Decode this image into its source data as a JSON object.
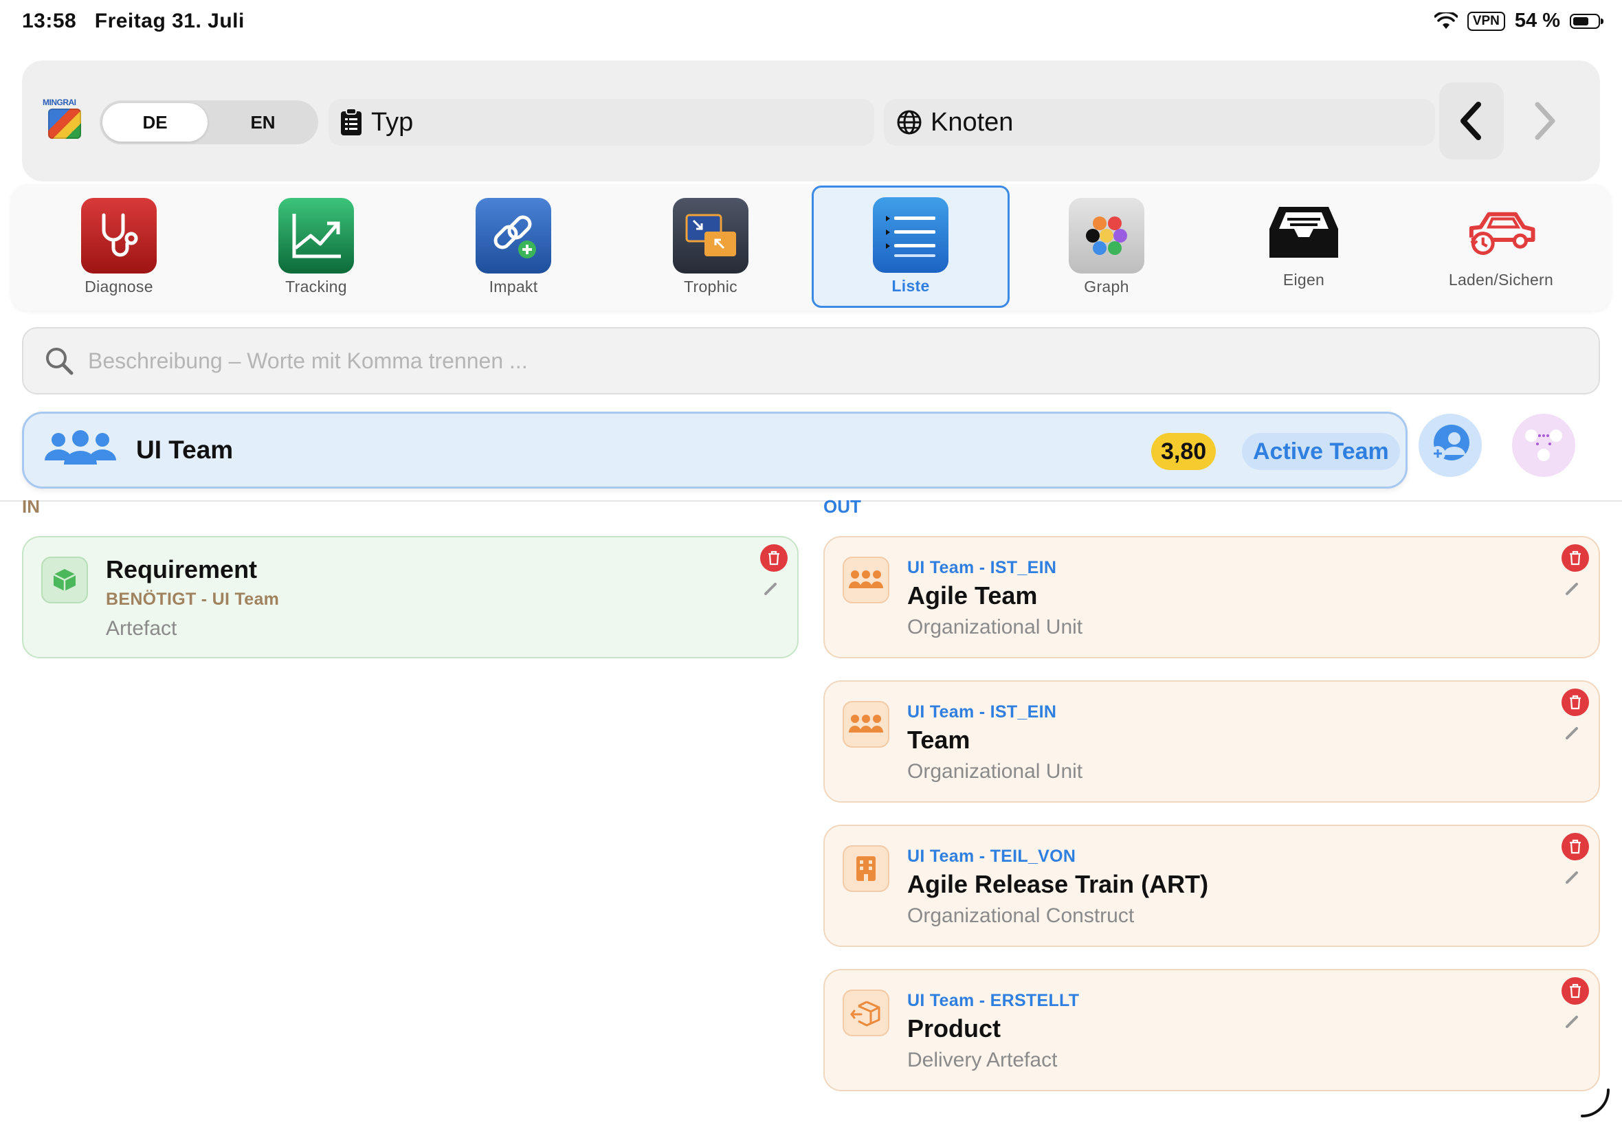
{
  "status_bar": {
    "time": "13:58",
    "date": "Freitag 31. Juli",
    "vpn": "VPN",
    "battery": "54 %"
  },
  "logo": {
    "text": "MINGRAI"
  },
  "language": {
    "active": "DE",
    "inactive": "EN"
  },
  "fields": {
    "type_label": "Typ",
    "node_label": "Knoten"
  },
  "tools": [
    {
      "label": "Diagnose",
      "icon": "stethoscope-icon"
    },
    {
      "label": "Tracking",
      "icon": "chart-trend-icon"
    },
    {
      "label": "Impakt",
      "icon": "link-add-icon"
    },
    {
      "label": "Trophic",
      "icon": "resize-arrows-icon"
    },
    {
      "label": "Liste",
      "icon": "list-icon",
      "selected": true
    },
    {
      "label": "Graph",
      "icon": "color-dots-icon"
    },
    {
      "label": "Eigen",
      "icon": "tray-icon"
    },
    {
      "label": "Laden/Sichern",
      "icon": "car-history-icon"
    }
  ],
  "search": {
    "placeholder": "Beschreibung – Worte mit Komma trennen ..."
  },
  "node": {
    "title": "UI Team",
    "score": "3,80",
    "status": "Active Team"
  },
  "sections": {
    "in": "IN",
    "out": "OUT"
  },
  "in_cards": [
    {
      "title": "Requirement",
      "relation": "BENÖTIGT - UI Team",
      "type": "Artefact"
    }
  ],
  "out_cards": [
    {
      "relation": "UI Team - IST_EIN",
      "title": "Agile Team",
      "type": "Organizational Unit"
    },
    {
      "relation": "UI Team - IST_EIN",
      "title": "Team",
      "type": "Organizational Unit"
    },
    {
      "relation": "UI Team - TEIL_VON",
      "title": "Agile Release Train (ART)",
      "type": "Organizational Construct"
    },
    {
      "relation": "UI Team - ERSTELLT",
      "title": "Product",
      "type": "Delivery Artefact"
    }
  ],
  "colors": {
    "accent": "#2f7fe0",
    "score": "#f6cb2e",
    "delete": "#e0393e",
    "in_card": "#eff8ef",
    "out_card": "#fdf4ec"
  }
}
